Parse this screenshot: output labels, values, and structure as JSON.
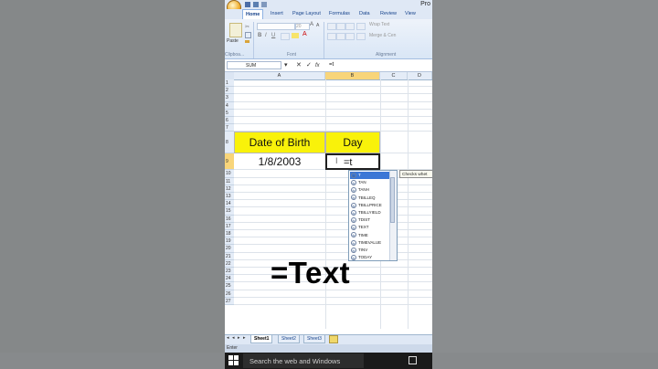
{
  "window": {
    "app_title": "Pro"
  },
  "ribbon": {
    "tabs": [
      "Home",
      "Insert",
      "Page Layout",
      "Formulas",
      "Data",
      "Review",
      "View"
    ],
    "font_size": "20",
    "paste_label": "Paste",
    "wrap_text_label": "Wrap Text",
    "merge_label": "Merge & Cen",
    "groups": {
      "clipboard": "Clipboa...",
      "font": "Font",
      "alignment": "Alignment"
    }
  },
  "formula_bar": {
    "name_box": "SUM",
    "value": "=t"
  },
  "columns": [
    "A",
    "B",
    "C",
    "D"
  ],
  "rows": [
    "1",
    "2",
    "3",
    "4",
    "5",
    "6",
    "7",
    "8",
    "9",
    "10",
    "11",
    "12",
    "13",
    "14",
    "15",
    "16",
    "17",
    "18",
    "19",
    "20",
    "21",
    "22",
    "23",
    "24",
    "25",
    "26",
    "27"
  ],
  "cells": {
    "a8": "Date of Birth",
    "b8": "Day",
    "a9": "1/8/2003",
    "b9": "=t"
  },
  "autocomplete": {
    "items": [
      "T",
      "TAN",
      "TANH",
      "TBILLEQ",
      "TBILLPRICE",
      "TBILLYIELD",
      "TDIST",
      "TEXT",
      "TIME",
      "TIMEVALUE",
      "TINV",
      "TODAY"
    ],
    "selected_index": 0,
    "tooltip": "Checks whet"
  },
  "caption": "=Text",
  "sheet_tabs": [
    "Sheet1",
    "Sheet2",
    "Sheet3"
  ],
  "status": "Enter",
  "taskbar": {
    "search_placeholder": "Search the web and Windows"
  },
  "colors": {
    "cell_highlight": "#f9f20a",
    "selection": "#3b77d6",
    "taskbar": "#1a1a1a"
  }
}
